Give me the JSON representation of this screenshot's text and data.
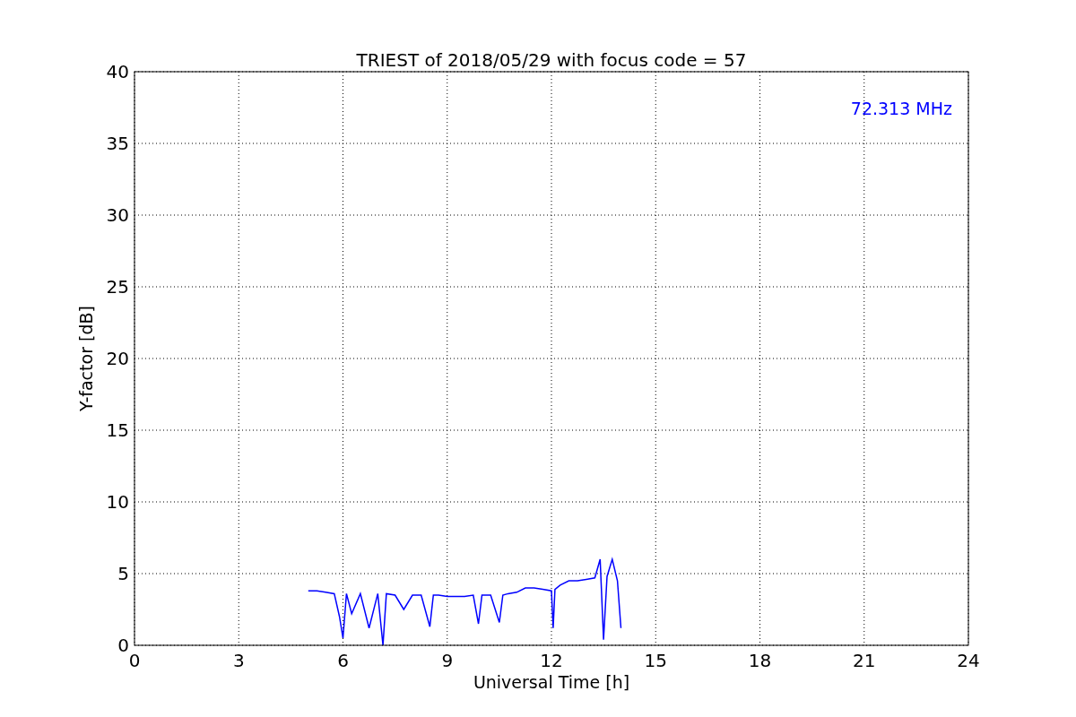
{
  "figure": {
    "chart_data": {
      "type": "line",
      "title": "TRIEST of 2018/05/29 with focus code = 57",
      "xlabel": "Universal Time [h]",
      "ylabel": "Y-factor [dB]",
      "xlim": [
        0,
        24
      ],
      "ylim": [
        0,
        40
      ],
      "xticks": [
        0,
        3,
        6,
        9,
        12,
        15,
        18,
        21,
        24
      ],
      "yticks": [
        0,
        5,
        10,
        15,
        20,
        25,
        30,
        35,
        40
      ],
      "x": [
        5.0,
        5.25,
        5.5,
        5.75,
        5.9,
        6.0,
        6.1,
        6.25,
        6.5,
        6.75,
        7.0,
        7.15,
        7.25,
        7.5,
        7.75,
        8.0,
        8.25,
        8.5,
        8.6,
        8.75,
        9.0,
        9.25,
        9.5,
        9.75,
        9.9,
        10.0,
        10.25,
        10.5,
        10.6,
        10.75,
        11.0,
        11.25,
        11.5,
        11.75,
        12.0,
        12.05,
        12.1,
        12.25,
        12.5,
        12.75,
        13.0,
        13.25,
        13.4,
        13.5,
        13.6,
        13.75,
        13.9,
        14.0
      ],
      "series": [
        {
          "name": "72.313 MHz",
          "color": "#0000ff",
          "values": [
            3.8,
            3.8,
            3.7,
            3.6,
            2.0,
            0.5,
            3.6,
            2.2,
            3.6,
            1.2,
            3.6,
            0.0,
            3.6,
            3.5,
            2.5,
            3.5,
            3.5,
            1.3,
            3.5,
            3.5,
            3.4,
            3.4,
            3.4,
            3.5,
            1.5,
            3.5,
            3.5,
            1.6,
            3.5,
            3.6,
            3.7,
            4.0,
            4.0,
            3.9,
            3.8,
            1.2,
            3.9,
            4.2,
            4.5,
            4.5,
            4.6,
            4.7,
            6.0,
            0.4,
            4.8,
            6.0,
            4.5,
            1.2
          ]
        }
      ],
      "grid": true
    }
  }
}
